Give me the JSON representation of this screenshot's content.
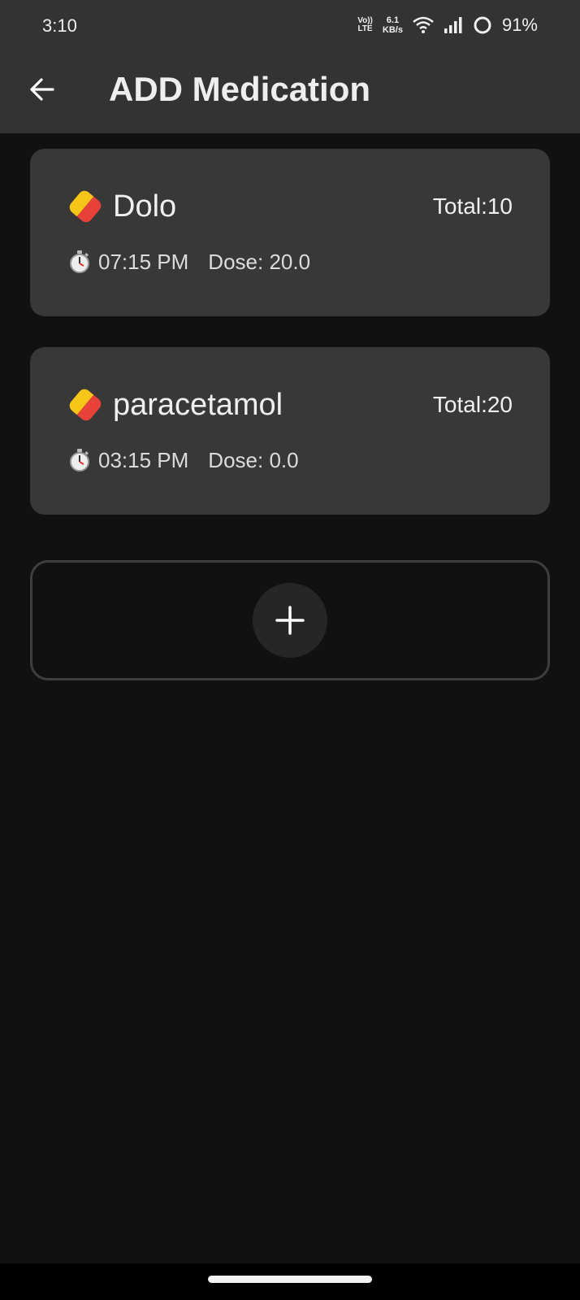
{
  "status_bar": {
    "time": "3:10",
    "volte_top": "Vo))",
    "volte_bottom": "LTE",
    "speed_value": "6.1",
    "speed_unit": "KB/s",
    "battery": "91%"
  },
  "app_bar": {
    "title": "ADD Medication",
    "back_icon": "arrow-left-icon"
  },
  "medications": [
    {
      "name": "Dolo",
      "total": "Total:10",
      "time": "07:15 PM",
      "dose": "Dose: 20.0"
    },
    {
      "name": "paracetamol",
      "total": "Total:20",
      "time": "03:15 PM",
      "dose": "Dose: 0.0"
    }
  ],
  "icons": {
    "pill": "pill-icon",
    "stopwatch": "stopwatch-icon",
    "add": "plus-icon"
  },
  "colors": {
    "background": "#111111",
    "app_bar": "#333333",
    "card": "#383838",
    "pill_red": "#e8413a",
    "pill_yellow": "#f5c518"
  }
}
